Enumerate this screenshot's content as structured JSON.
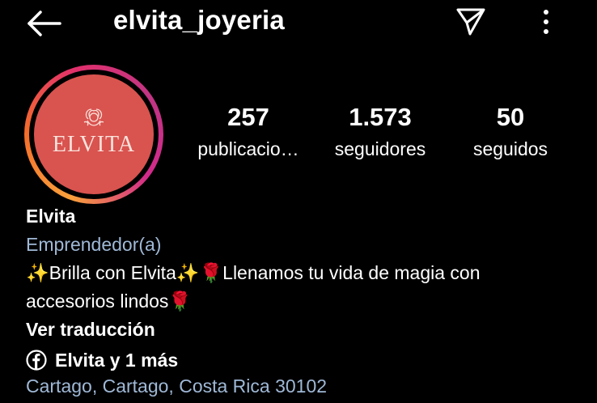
{
  "header": {
    "username": "elvita_joyeria",
    "icons": {
      "back": "arrow-left-icon",
      "send": "send-message-icon",
      "more": "more-vertical-icon"
    }
  },
  "avatar": {
    "brand_text": "ELVITA",
    "icon": "rose-logo-icon",
    "colors": {
      "background": "#d9534f",
      "ring_start": "#f9a13b",
      "ring_end": "#c13584"
    }
  },
  "stats": {
    "posts": {
      "value": "257",
      "label": "publicacio…"
    },
    "followers": {
      "value": "1.573",
      "label": "seguidores"
    },
    "following": {
      "value": "50",
      "label": "seguidos"
    }
  },
  "bio": {
    "name": "Elvita",
    "category": "Emprendedor(a)",
    "line1": "Brilla con Elvita",
    "line1_rest": "Llenamos tu vida de magia con",
    "line2": "accesorios lindos",
    "translate": "Ver traducción",
    "facebook_link": "Elvita y 1 más",
    "location": "Cartago, Cartago, Costa Rica 30102",
    "emoji": {
      "sparkle": "✨",
      "rose": "🌹"
    }
  }
}
